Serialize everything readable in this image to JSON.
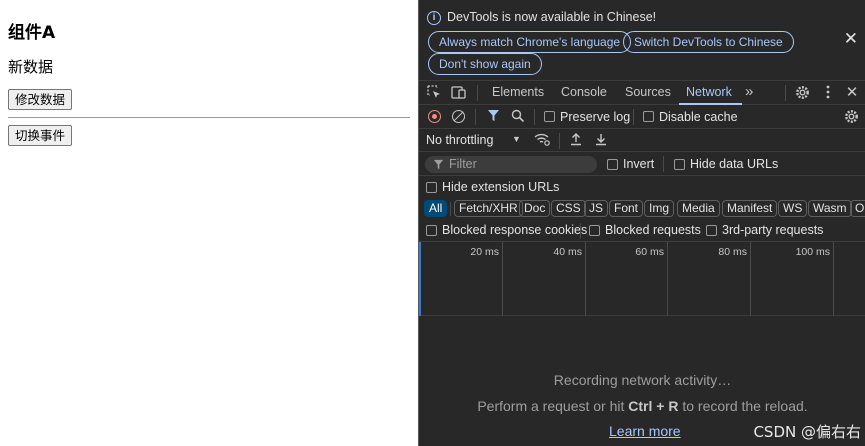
{
  "page": {
    "heading": "组件A",
    "message": "新数据",
    "modify_button": "修改数据",
    "switch_button": "切换事件"
  },
  "devtools": {
    "infobar": {
      "text": "DevTools is now available in Chinese!",
      "always_match": "Always match Chrome's language",
      "switch_to_chinese": "Switch DevTools to Chinese",
      "dont_show": "Don't show again",
      "close": "✕"
    },
    "tabs": {
      "elements": "Elements",
      "console": "Console",
      "sources": "Sources",
      "network": "Network",
      "more": "»"
    },
    "toolbar": {
      "preserve_log": "Preserve log",
      "disable_cache": "Disable cache",
      "throttling": "No throttling"
    },
    "filter": {
      "placeholder": "Filter",
      "invert": "Invert",
      "hide_data_urls": "Hide data URLs",
      "hide_extension_urls": "Hide extension URLs"
    },
    "types": [
      "All",
      "Fetch/XHR",
      "Doc",
      "CSS",
      "JS",
      "Font",
      "Img",
      "Media",
      "Manifest",
      "WS",
      "Wasm",
      "O"
    ],
    "blocked": {
      "blocked_response_cookies": "Blocked response cookies",
      "blocked_requests": "Blocked requests",
      "third_party_requests": "3rd-party requests"
    },
    "timeline": {
      "labels": [
        "20 ms",
        "40 ms",
        "60 ms",
        "80 ms",
        "100 ms"
      ]
    },
    "empty": {
      "recording": "Recording network activity…",
      "perform_prefix": "Perform a request or hit ",
      "shortcut": "Ctrl + R",
      "perform_suffix": " to record the reload.",
      "learn_more": "Learn more"
    }
  },
  "watermark": "CSDN @偏右右",
  "colors": {
    "devtools_bg": "#282828",
    "accent": "#a8c7fa",
    "record_red": "#f28b82",
    "active_chip": "#004a77"
  }
}
